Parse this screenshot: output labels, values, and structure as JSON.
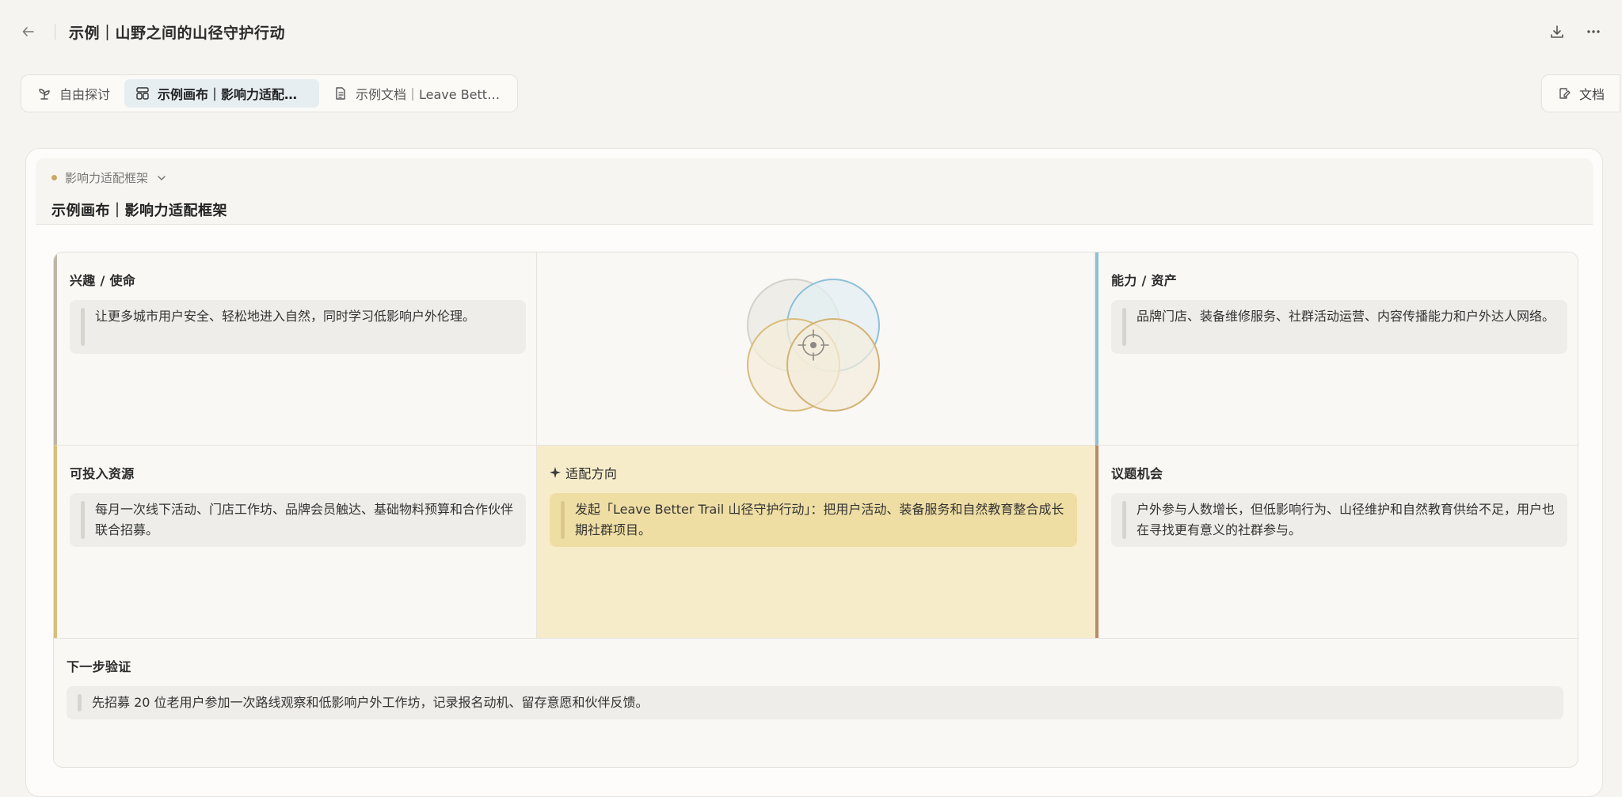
{
  "header": {
    "title": "示例｜山野之间的山径守护行动",
    "back_icon": "arrow-left-icon",
    "download_icon": "download-icon",
    "more_icon": "more-icon"
  },
  "tabs": [
    {
      "label": "自由探讨",
      "icon": "sprout-icon",
      "active": false
    },
    {
      "label": "示例画布｜影响力适配框架",
      "icon": "canvas-layout-icon",
      "active": true
    },
    {
      "label": "示例文档｜Leave Better Trail",
      "icon": "document-icon",
      "active": false
    }
  ],
  "doc_button": {
    "label": "文档",
    "icon": "edit-note-icon"
  },
  "card": {
    "crumb": "影响力适配框架",
    "title": "示例画布｜影响力适配框架"
  },
  "board": {
    "interest": {
      "heading": "兴趣 / 使命",
      "text": "让更多城市用户安全、轻松地进入自然，同时学习低影响户外伦理。"
    },
    "ability": {
      "heading": "能力 / 资产",
      "text": "品牌门店、装备维修服务、社群活动运营、内容传播能力和户外达人网络。"
    },
    "resource": {
      "heading": "可投入资源",
      "text": "每月一次线下活动、门店工作坊、品牌会员触达、基础物料预算和合作伙伴联合招募。"
    },
    "fit": {
      "heading": "适配方向",
      "text": "发起「Leave Better Trail 山径守护行动」：把用户活动、装备服务和自然教育整合成长期社群项目。"
    },
    "issue": {
      "heading": "议题机会",
      "text": "户外参与人数增长，但低影响行为、山径维护和自然教育供给不足，用户也在寻找更有意义的社群参与。"
    },
    "next": {
      "heading": "下一步验证",
      "text": "先招募 20 位老用户参加一次路线观察和低影响户外工作坊，记录报名动机、留存意愿和伙伴反馈。"
    }
  },
  "colors": {
    "accent_tab": "#e7eef2",
    "fit_bg": "#f6ecca",
    "venn_blue": "#8ec0d8",
    "venn_gold": "#d9bd7c"
  }
}
